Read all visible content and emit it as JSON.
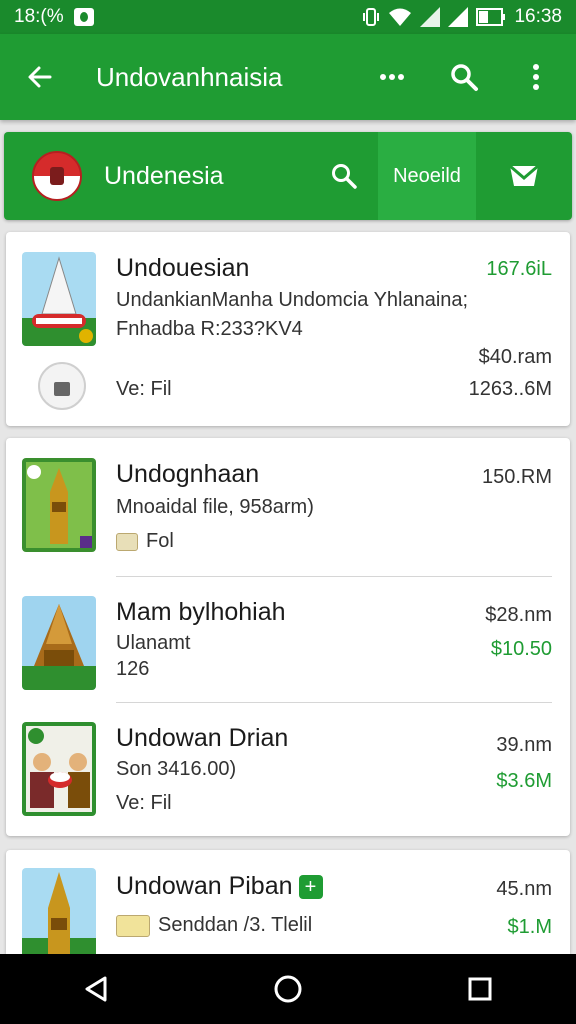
{
  "status_bar": {
    "time_left": "18:(%",
    "time_right": "16:38"
  },
  "app_bar": {
    "title": "Undovanhnaisia"
  },
  "sub_bar": {
    "title": "Undenesia",
    "tab_label": "Neoeild"
  },
  "items": [
    {
      "name": "Undouesian",
      "line1": "UndankianManha Undomcia Yhlanaina;",
      "line2": "Fnhadba R:233?KV4",
      "right_top": "167.6iL",
      "right_mid": "$40.ram",
      "meta": "Ve: Fil",
      "right_bottom": "1263..6M"
    },
    {
      "name": "Undognhaan",
      "line1": "Mnoaidal file,   958arm)",
      "line2": "Fol",
      "right_top": "150.RM"
    },
    {
      "name": "Mam bylhohiah",
      "line1": "Ulanamt",
      "line2": "126",
      "right_top": "$28.nm",
      "right_bottom": "$10.50"
    },
    {
      "name": "Undowan Drian",
      "line1": "Son 3416.00)",
      "line2": "Ve: Fil",
      "right_top": "39.nm",
      "right_bottom": "$3.6M"
    },
    {
      "name": "Undowan Piban",
      "line1": "Senddan /3. Tlelil",
      "badge": "+",
      "right_top": "45.nm",
      "right_bottom": "$1.M"
    }
  ],
  "colors": {
    "primary": "#1f9c33",
    "status": "#1a8a2c",
    "accent_text": "#1f9c33"
  }
}
